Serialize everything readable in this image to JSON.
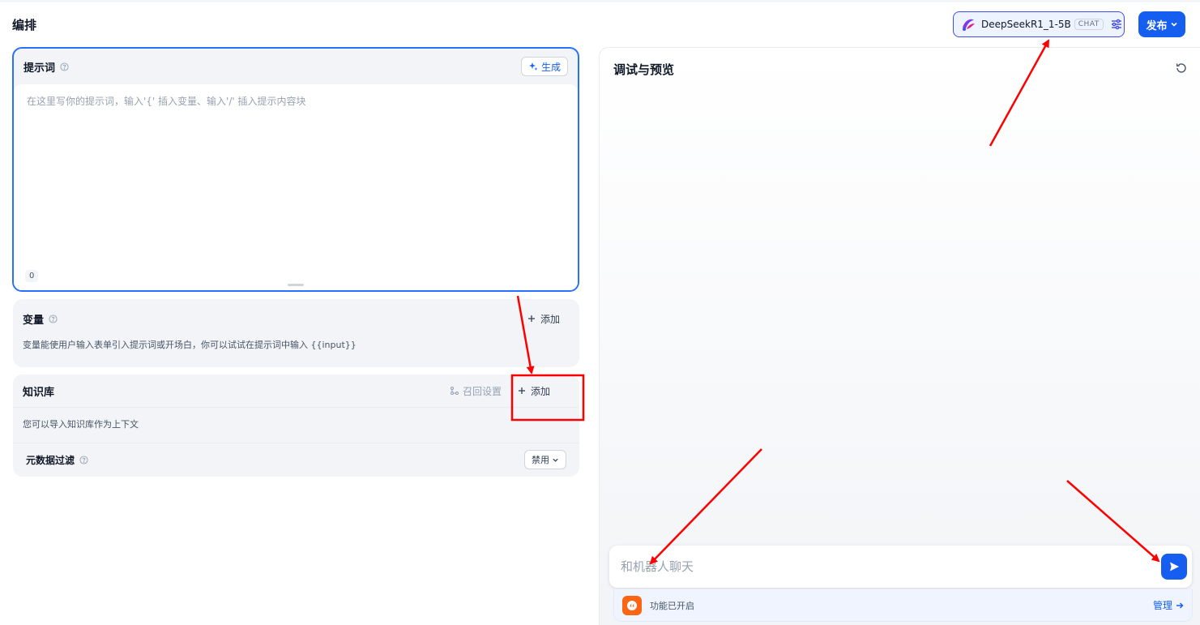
{
  "page": {
    "title": "编排"
  },
  "header": {
    "model": {
      "name": "DeepSeekR1_1-5B",
      "tag": "CHAT"
    },
    "publish_label": "发布"
  },
  "prompt": {
    "title": "提示词",
    "generate_label": "生成",
    "placeholder": "在这里写你的提示词，输入'{' 插入变量、输入'/' 插入提示内容块",
    "char_count": "0"
  },
  "variables": {
    "title": "变量",
    "add_label": "添加",
    "description": "变量能使用户输入表单引入提示词或开场白，你可以试试在提示词中输入 {{input}}"
  },
  "knowledge": {
    "title": "知识库",
    "recall_label": "召回设置",
    "add_label": "添加",
    "description": "您可以导入知识库作为上下文",
    "metadata_filter": {
      "title": "元数据过滤",
      "value": "禁用"
    }
  },
  "debug": {
    "title": "调试与预览",
    "input_placeholder": "和机器人聊天",
    "feature_status": "功能已开启",
    "manage_label": "管理"
  },
  "colors": {
    "accent": "#155eef",
    "annotation": "#ff0000",
    "feature_icon": "#fb6514"
  }
}
